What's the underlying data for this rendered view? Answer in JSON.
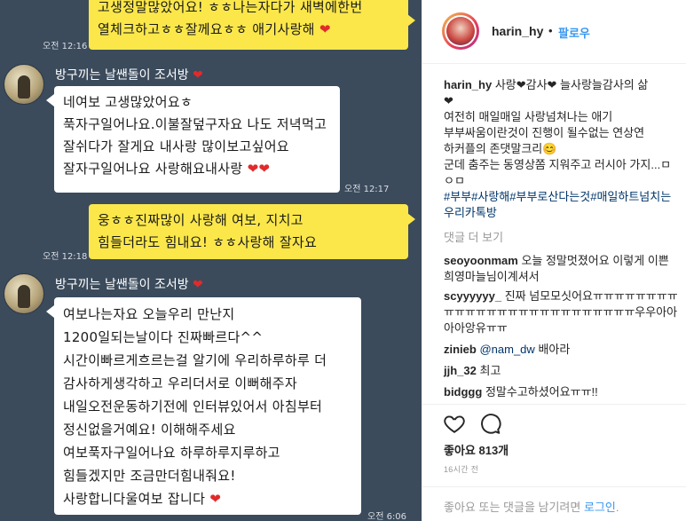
{
  "chat": {
    "messages": [
      {
        "type": "sent",
        "lines": [
          "고생정말많았어요! ㅎㅎ나는자다가 새벽에한번",
          "열체크하고ㅎㅎ잘께요ㅎㅎ 애기사랑해"
        ],
        "time": "오전 12:16"
      },
      {
        "type": "received",
        "sender": "방구끼는 날쌘돌이 조서방",
        "lines": [
          "네여보 고생많았어요ㅎ",
          "푹자구일어나요.이불잘덮구자요 나도 저녁먹고",
          "잘쉬다가 잘게요 내사랑 많이보고싶어요",
          "잘자구일어나요 사랑해요내사랑"
        ],
        "time": "오전 12:17"
      },
      {
        "type": "sent",
        "lines": [
          "웅ㅎㅎ진짜많이 사랑해 여보, 지치고",
          "힘들더라도 힘내요! ㅎㅎ사랑해 잘자요"
        ],
        "time": "오전 12:18"
      },
      {
        "type": "received",
        "sender": "방구끼는 날쌘돌이 조서방",
        "lines": [
          "여보나는자요 오늘우리 만난지",
          "1200일되는날이다 진짜빠르다^^",
          "시간이빠르게흐르는걸 알기에 우리하루하루 더",
          "감사하게생각하고 우리더서로 이뻐해주자",
          "내일오전운동하기전에 인터뷰있어서 아침부터",
          "정신없을거예요! 이해해주세요",
          "여보푹자구일어나요 하루하루지루하고",
          "힘들겠지만 조금만더힘내줘요!",
          "사랑합니다울여보 잡니다"
        ],
        "time": "오전 6:06"
      }
    ]
  },
  "post": {
    "username": "harin_hy",
    "separator": "•",
    "follow_label": "팔로우",
    "caption_user": "harin_hy",
    "caption_lines": [
      "사랑❤감사❤ 늘사랑늘감사의 삶",
      "❤",
      "여전히 매일매일 사랑넘쳐나는 애기",
      "부부싸움이란것이 진행이 될수없는 연상연",
      "하커플의 존댓말크리😊",
      "군데 춤주는 동영상쫌 지워주고 러시아 가지...ㅁㅇㅁ"
    ],
    "tags": "#부부#사랑해#부부로산다는것#매일하트넘치는우리카톡방",
    "more_comments": "댓글 더 보기",
    "comments": [
      {
        "user": "seoyoonmam",
        "text": "오늘 정말멋졌어요 이렇게 이쁜 희영마늘님이계셔서"
      },
      {
        "user": "scyyyyyy_",
        "text": "진짜 넘모모싯어요ㅠㅠㅠㅠㅠㅠㅠㅠㅠㅠㅠㅠㅠㅠㅠㅠㅠㅠㅠㅠㅠㅠㅠㅠㅠㅠ우우아아아아앙유ㅠㅠ"
      },
      {
        "user": "zinieb",
        "mention": "@nam_dw",
        "text": "배아라"
      },
      {
        "user": "jjh_32",
        "text": "최고"
      },
      {
        "user": "bidggg",
        "text": "정말수고하셨어요ㅠㅠ!!"
      }
    ],
    "likes": "좋아요 813개",
    "time_ago": "16시간 전",
    "login_prompt": "좋아요 또는 댓글을 남기려면",
    "login_link": "로그인",
    "login_suffix": "."
  },
  "icons": {
    "like": "heart-outline-icon",
    "comment": "speech-bubble-icon"
  },
  "colors": {
    "chat_bg": "#3b4b5c",
    "sent_bubble": "#fbe74a",
    "received_bubble": "#ffffff",
    "link_blue": "#3897f0",
    "hashtag": "#003569"
  }
}
